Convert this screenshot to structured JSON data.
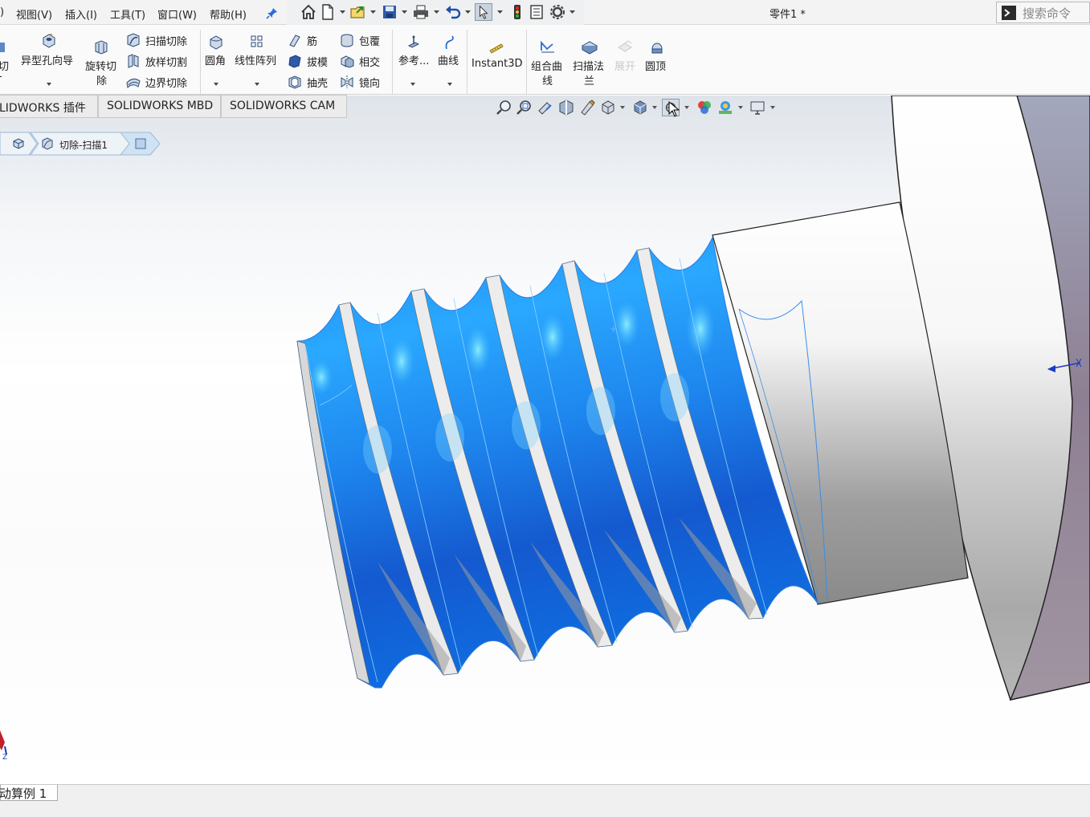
{
  "menubar": {
    "items": [
      {
        "label": ")",
        "name": "menu-file-fragment"
      },
      {
        "label": "视图(V)",
        "name": "menu-view"
      },
      {
        "label": "插入(I)",
        "name": "menu-insert"
      },
      {
        "label": "工具(T)",
        "name": "menu-tools"
      },
      {
        "label": "窗口(W)",
        "name": "menu-window"
      },
      {
        "label": "帮助(H)",
        "name": "menu-help"
      }
    ]
  },
  "quick_access": {
    "icons": [
      "pin-icon",
      "home-icon",
      "new-document-icon",
      "open-folder-icon",
      "save-icon",
      "print-icon",
      "undo-icon",
      "select-cursor-icon",
      "rebuild-traffic-light-icon",
      "file-properties-icon",
      "options-gear-icon"
    ]
  },
  "title_bar": {
    "document_title": "零件1 *"
  },
  "search": {
    "placeholder": "搜索命令"
  },
  "ribbon": {
    "left_fragment_1": "切",
    "left_fragment_2": "-",
    "hole_wizard": "异型孔向导",
    "revolved_cut_1": "旋转切",
    "revolved_cut_2": "除",
    "swept_cut": "扫描切除",
    "lofted_cut": "放样切割",
    "boundary_cut": "边界切除",
    "fillet": "圆角",
    "linear_pattern": "线性阵列",
    "rib": "筋",
    "draft": "拔模",
    "shell": "抽壳",
    "wrap": "包覆",
    "intersect": "相交",
    "mirror": "镜向",
    "reference": "参考...",
    "curves": "曲线",
    "instant3d": "Instant3D",
    "composite_curve_1": "组合曲",
    "composite_curve_2": "线",
    "swept_flange_1": "扫描法",
    "swept_flange_2": "兰",
    "unfold": "展开",
    "dome": "圆顶"
  },
  "command_tabs": [
    {
      "label": "LIDWORKS 插件"
    },
    {
      "label": "SOLIDWORKS MBD"
    },
    {
      "label": "SOLIDWORKS CAM"
    }
  ],
  "heads_up_toolbar": {
    "icons": [
      "zoom-to-fit-icon",
      "zoom-to-area-icon",
      "previous-view-icon",
      "section-view-icon",
      "dynamic-annotation-icon",
      "view-orientation-icon",
      "display-style-icon",
      "hide-show-items-icon",
      "edit-appearance-icon",
      "apply-scene-icon",
      "view-settings-icon"
    ]
  },
  "breadcrumb": {
    "feature_label": "切除-扫描1"
  },
  "status": {
    "sheet_tab_label": "动算例 1"
  },
  "colors": {
    "thread_blue": "#1f86f0",
    "thread_blue_dark": "#1248b8",
    "highlight_cyan": "#6fe0ff",
    "head_side_mauve": "#9a8b98",
    "shaft_gray": "#cfcfcf"
  }
}
